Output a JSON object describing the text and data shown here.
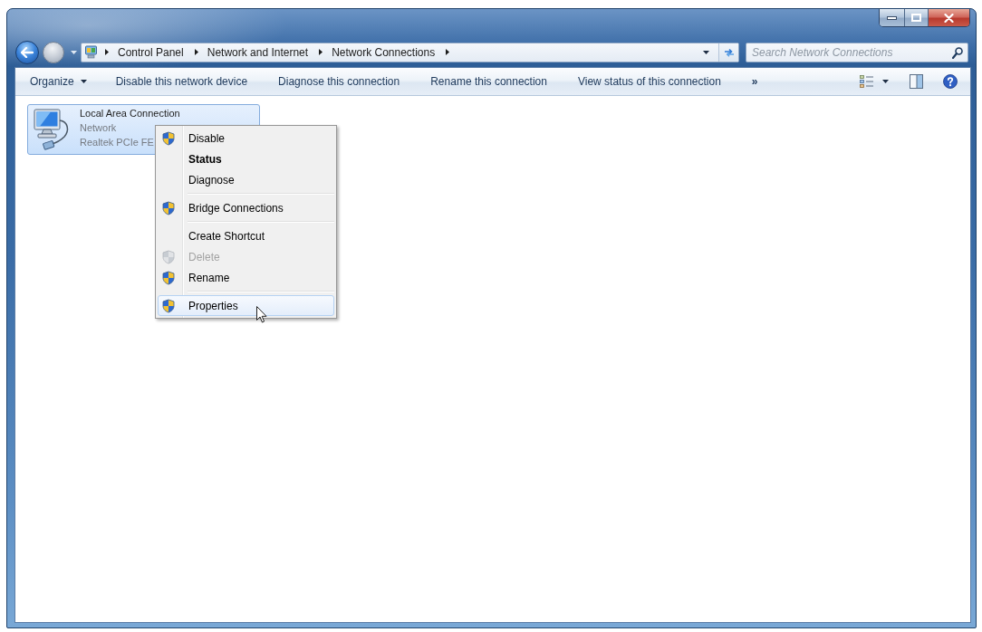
{
  "address_bar": {
    "breadcrumbs": [
      "Control Panel",
      "Network and Internet",
      "Network Connections"
    ]
  },
  "search": {
    "placeholder": "Search Network Connections"
  },
  "toolbar": {
    "commands": [
      {
        "label": "Organize",
        "kind": "menu"
      },
      {
        "label": "Disable this network device",
        "kind": "command"
      },
      {
        "label": "Diagnose this connection",
        "kind": "command"
      },
      {
        "label": "Rename this connection",
        "kind": "command"
      },
      {
        "label": "View status of this connection",
        "kind": "command"
      },
      {
        "label": "»",
        "kind": "overflow"
      }
    ]
  },
  "connections": [
    {
      "name": "Local Area Connection",
      "status": "Network",
      "device": "Realtek PCIe FE",
      "selected": true
    }
  ],
  "context_menu": {
    "groups": [
      {
        "items": [
          {
            "label": "Disable",
            "shield": true,
            "default": false,
            "disabled": false,
            "selected": false
          },
          {
            "label": "Status",
            "shield": false,
            "default": true,
            "disabled": false,
            "selected": false
          },
          {
            "label": "Diagnose",
            "shield": false,
            "default": false,
            "disabled": false,
            "selected": false
          }
        ]
      },
      {
        "items": [
          {
            "label": "Bridge Connections",
            "shield": true,
            "default": false,
            "disabled": false,
            "selected": false
          }
        ]
      },
      {
        "items": [
          {
            "label": "Create Shortcut",
            "shield": false,
            "default": false,
            "disabled": false,
            "selected": false
          },
          {
            "label": "Delete",
            "shield": true,
            "default": false,
            "disabled": true,
            "selected": false
          },
          {
            "label": "Rename",
            "shield": true,
            "default": false,
            "disabled": false,
            "selected": false
          }
        ]
      },
      {
        "items": [
          {
            "label": "Properties",
            "shield": true,
            "default": false,
            "disabled": false,
            "selected": true
          }
        ]
      }
    ]
  }
}
